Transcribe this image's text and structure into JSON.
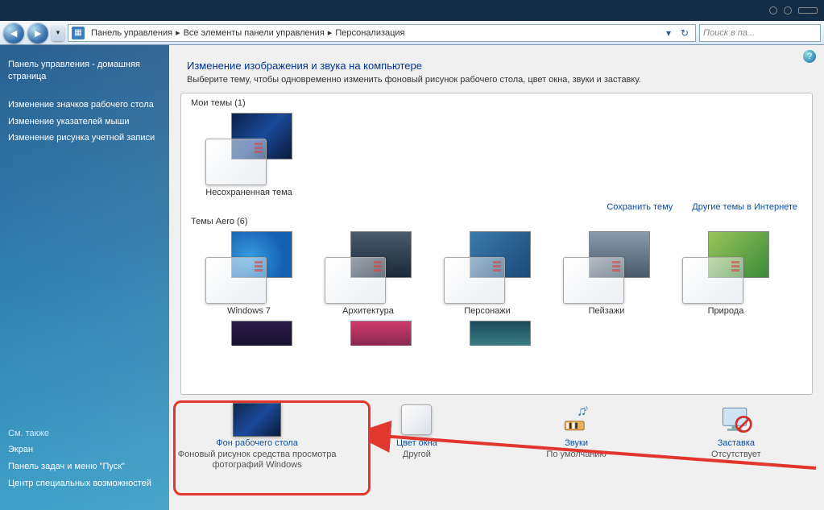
{
  "titlebar_buttons": [
    "minimize",
    "maximize",
    "close"
  ],
  "nav": {
    "back_tip": "Назад",
    "forward_tip": "Вперёд",
    "crumb_icon": "control-panel-icon",
    "crumbs": [
      "Панель управления",
      "Все элементы панели управления",
      "Персонализация"
    ],
    "refresh_icon": "refresh-icon",
    "dropdown_icon": "chevron-down-icon",
    "search_placeholder": "Поиск в па..."
  },
  "sidebar": {
    "links": [
      "Панель управления - домашняя страница",
      "Изменение значков рабочего стола",
      "Изменение указателей мыши",
      "Изменение рисунка учетной записи"
    ],
    "see_also_label": "См. также",
    "see_also": [
      "Экран",
      "Панель задач и меню \"Пуск\"",
      "Центр специальных возможностей"
    ]
  },
  "content": {
    "help_tip": "Справка",
    "heading": "Изменение изображения и звука на компьютере",
    "subheading": "Выберите тему, чтобы одновременно изменить фоновый рисунок рабочего стола, цвет окна, звуки и заставку.",
    "my_themes_label": "Мои темы (1)",
    "my_themes": [
      {
        "name": "Несохраненная тема",
        "style": "default"
      }
    ],
    "save_theme_link": "Сохранить тему",
    "more_themes_link": "Другие темы в Интернете",
    "aero_label": "Темы Aero (6)",
    "aero_themes": [
      {
        "name": "Windows 7",
        "style": "w7"
      },
      {
        "name": "Архитектура",
        "style": "arch"
      },
      {
        "name": "Персонажи",
        "style": "char"
      },
      {
        "name": "Пейзажи",
        "style": "land"
      },
      {
        "name": "Природа",
        "style": "nat"
      }
    ],
    "partial_row_styles": [
      "sc1",
      "sc2",
      "sc3"
    ]
  },
  "quick_settings": {
    "bg": {
      "title": "Фон рабочего стола",
      "sub": "Фоновый рисунок средства просмотра фотографий Windows"
    },
    "color": {
      "title": "Цвет окна",
      "sub": "Другой"
    },
    "sounds": {
      "title": "Звуки",
      "sub": "По умолчанию"
    },
    "saver": {
      "title": "Заставка",
      "sub": "Отсутствует"
    }
  },
  "annotation": {
    "highlight": "bg-setting",
    "arrow_from": "saver",
    "arrow_to": "bg"
  }
}
